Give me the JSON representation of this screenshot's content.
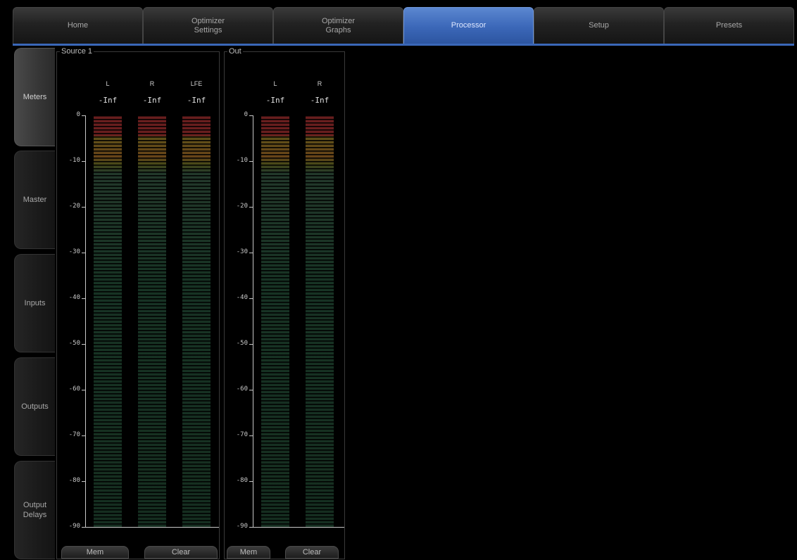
{
  "top_tabs": [
    {
      "label": "Home"
    },
    {
      "label": "Optimizer\nSettings"
    },
    {
      "label": "Optimizer\nGraphs"
    },
    {
      "label": "Processor"
    },
    {
      "label": "Setup"
    },
    {
      "label": "Presets"
    }
  ],
  "active_top_tab": "Processor",
  "side_tabs": [
    {
      "label": "Meters"
    },
    {
      "label": "Master"
    },
    {
      "label": "Inputs"
    },
    {
      "label": "Outputs"
    },
    {
      "label": "Output\nDelays"
    }
  ],
  "active_side_tab": "Meters",
  "scale_labels": [
    "0",
    "-10",
    "-20",
    "-30",
    "-40",
    "-50",
    "-60",
    "-70",
    "-80",
    "-90"
  ],
  "source_panel": {
    "title": "Source 1",
    "channels": [
      {
        "label": "L",
        "peak": "-Inf"
      },
      {
        "label": "R",
        "peak": "-Inf"
      },
      {
        "label": "LFE",
        "peak": "-Inf"
      }
    ],
    "buttons": {
      "mem": "Mem",
      "clear": "Clear"
    }
  },
  "out_panel": {
    "title": "Out",
    "channels": [
      {
        "label": "L",
        "peak": "-Inf"
      },
      {
        "label": "R",
        "peak": "-Inf"
      }
    ],
    "buttons": {
      "mem": "Mem",
      "clear": "Clear"
    }
  },
  "colors": {
    "accent": "#3b67b8",
    "meter_red": "#8a2828",
    "meter_yellow": "#8a6a20",
    "meter_green": "#1f4430"
  }
}
